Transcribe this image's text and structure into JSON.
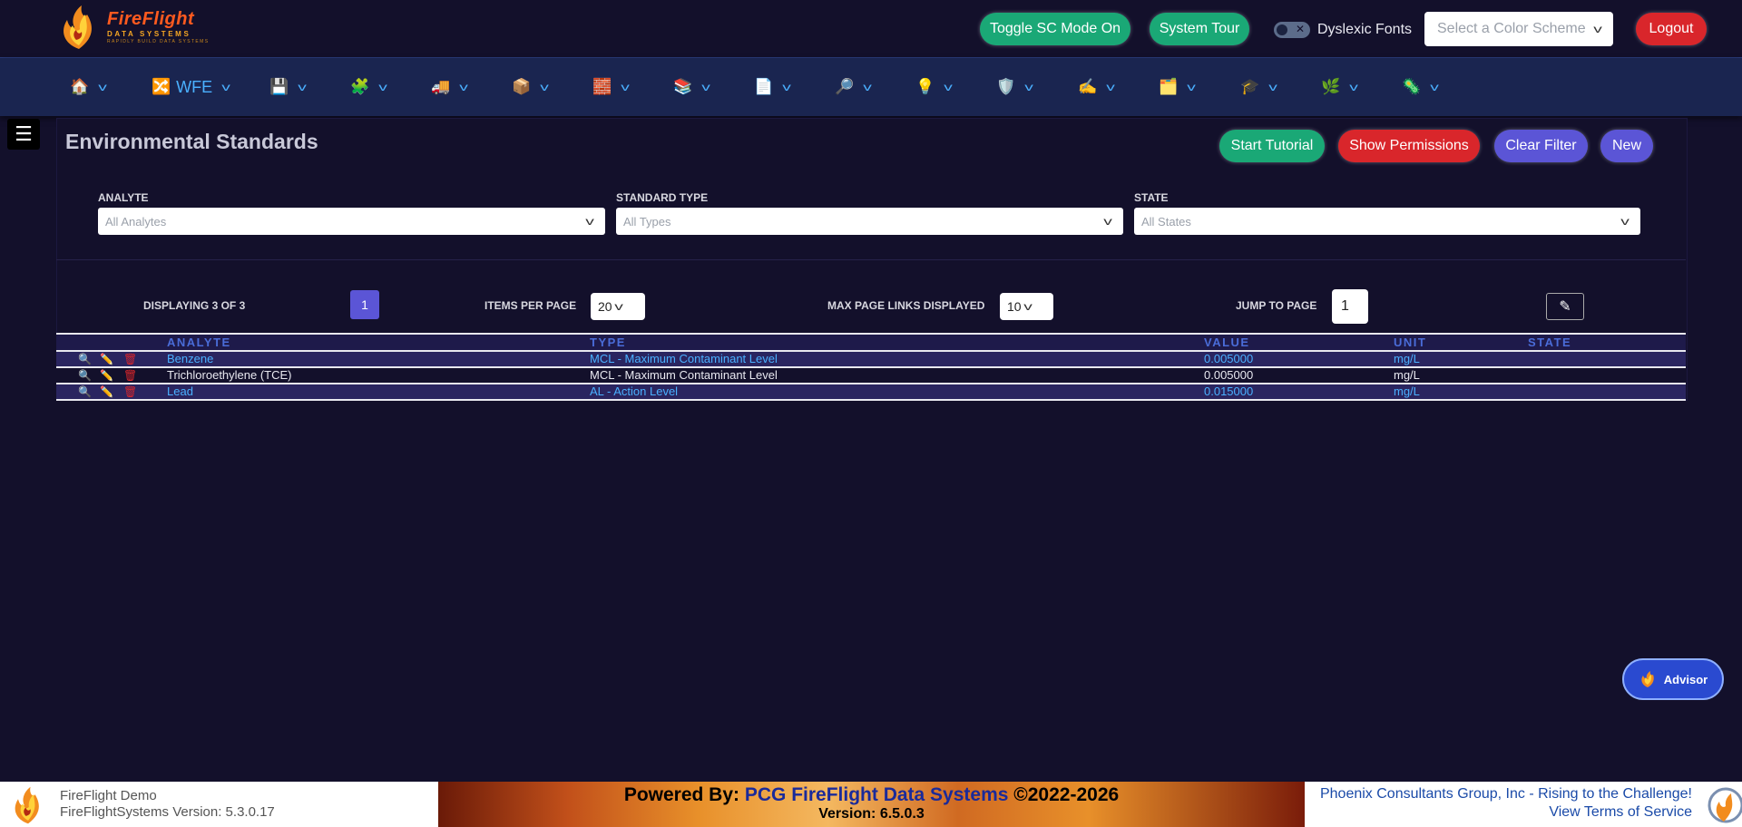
{
  "brand": {
    "name": "FireFlight",
    "sub": "DATA SYSTEMS",
    "tagline": "RAPIDLY BUILD DATA SYSTEMS"
  },
  "header": {
    "sc_mode_label": "Toggle SC Mode On",
    "tour_label": "System Tour",
    "dyslexic_label": "Dyslexic Fonts",
    "color_scheme_placeholder": "Select a Color Scheme",
    "logout_label": "Logout"
  },
  "nav": {
    "items": [
      {
        "icon": "🏠",
        "label": ""
      },
      {
        "icon": "🔀",
        "label": "WFE"
      },
      {
        "icon": "💾",
        "label": ""
      },
      {
        "icon": "🧩",
        "label": ""
      },
      {
        "icon": "🚚",
        "label": ""
      },
      {
        "icon": "📦",
        "label": ""
      },
      {
        "icon": "🧱",
        "label": ""
      },
      {
        "icon": "📚",
        "label": ""
      },
      {
        "icon": "📄",
        "label": ""
      },
      {
        "icon": "🔎",
        "label": ""
      },
      {
        "icon": "💡",
        "label": ""
      },
      {
        "icon": "🛡️",
        "label": ""
      },
      {
        "icon": "✍️",
        "label": ""
      },
      {
        "icon": "🗂️",
        "label": ""
      },
      {
        "icon": "🎓",
        "label": ""
      },
      {
        "icon": "🌿",
        "label": ""
      },
      {
        "icon": "🦠",
        "label": ""
      }
    ]
  },
  "page": {
    "title": "Environmental Standards",
    "start_tutorial": "Start Tutorial",
    "show_permissions": "Show Permissions",
    "clear_filter": "Clear Filter",
    "new_label": "New"
  },
  "filters": {
    "analyte": {
      "label": "ANALYTE",
      "placeholder": "All Analytes"
    },
    "type": {
      "label": "STANDARD TYPE",
      "placeholder": "All Types"
    },
    "state": {
      "label": "STATE",
      "placeholder": "All States"
    }
  },
  "pager": {
    "displaying": "DISPLAYING 3 OF 3",
    "current_page": "1",
    "items_per_page_label": "ITEMS PER PAGE",
    "items_per_page": "20",
    "max_links_label": "MAX PAGE LINKS DISPLAYED",
    "max_links": "10",
    "jump_label": "JUMP TO PAGE",
    "jump_value": "1"
  },
  "table": {
    "headers": [
      "ANALYTE",
      "TYPE",
      "VALUE",
      "UNIT",
      "STATE"
    ],
    "rows": [
      {
        "analyte": "Benzene",
        "type": "MCL - Maximum Contaminant Level",
        "value": "0.005000",
        "unit": "mg/L",
        "state": ""
      },
      {
        "analyte": "Trichloroethylene (TCE)",
        "type": "MCL - Maximum Contaminant Level",
        "value": "0.005000",
        "unit": "mg/L",
        "state": ""
      },
      {
        "analyte": "Lead",
        "type": "AL - Action Level",
        "value": "0.015000",
        "unit": "mg/L",
        "state": ""
      }
    ]
  },
  "advisor": {
    "label": "Advisor"
  },
  "footer": {
    "left_line1": "FireFlight Demo",
    "left_line2": "FireFlightSystems Version: 5.3.0.17",
    "banner_prefix": "Powered By: ",
    "banner_brand": "PCG FireFlight Data Systems",
    "banner_suffix": " ©2022-2026",
    "banner_version": "Version: 6.5.0.3",
    "right_line1": "Phoenix Consultants Group, Inc - Rising to the Challenge!",
    "right_line2": "View Terms of Service"
  }
}
